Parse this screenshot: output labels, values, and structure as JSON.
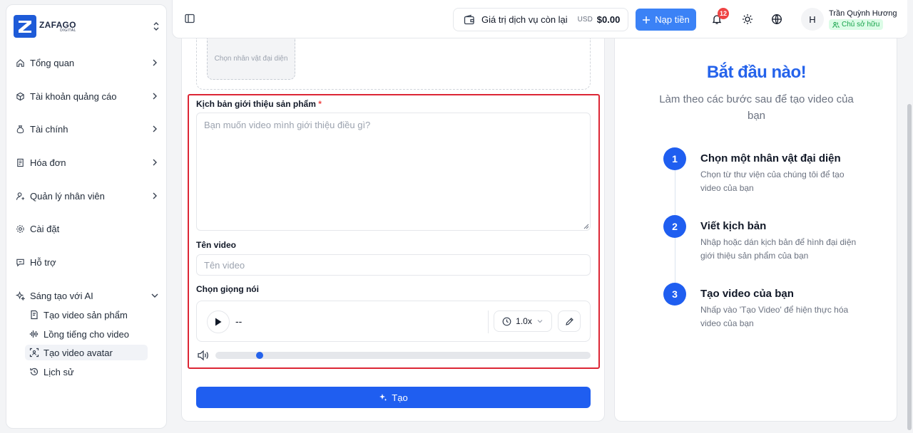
{
  "brand": {
    "name": "ZAFAGO",
    "sub": "DIGITAL",
    "color": "#1e5bd8"
  },
  "sidebar": {
    "items": [
      {
        "label": "Tổng quan",
        "icon": "home-icon",
        "has_chevron": true
      },
      {
        "label": "Tài khoản quảng cáo",
        "icon": "cube-icon",
        "has_chevron": true
      },
      {
        "label": "Tài chính",
        "icon": "money-bag-icon",
        "has_chevron": true
      },
      {
        "label": "Hóa đơn",
        "icon": "receipt-icon",
        "has_chevron": true
      },
      {
        "label": "Quản lý nhân viên",
        "icon": "user-icon",
        "has_chevron": true
      },
      {
        "label": "Cài đặt",
        "icon": "gear-icon",
        "has_chevron": false
      },
      {
        "label": "Hỗ trợ",
        "icon": "chat-icon",
        "has_chevron": false
      },
      {
        "label": "Sáng tạo với AI",
        "icon": "sparkle-icon",
        "expanded": true
      }
    ],
    "subitems": [
      {
        "label": "Tạo video sản phẩm",
        "icon": "document-edit-icon"
      },
      {
        "label": "Lồng tiếng cho video",
        "icon": "audio-wave-icon"
      },
      {
        "label": "Tạo video avatar",
        "icon": "face-scan-icon",
        "active": true
      },
      {
        "label": "Lịch sử",
        "icon": "history-icon"
      }
    ]
  },
  "header": {
    "balance_label": "Giá trị dịch vụ còn lại",
    "currency": "USD",
    "amount": "$0.00",
    "topup_label": "Nạp tiền",
    "notifications": "12",
    "user_initial": "H",
    "user_name": "Trần Quỳnh Hương",
    "user_role": "Chủ sở hữu",
    "accent": "#3b82f6"
  },
  "form": {
    "avatar_slot_label": "Chọn nhân vật đại diện",
    "script_label": "Kịch bản giới thiệu sản phẩm",
    "script_required": "*",
    "script_value": "",
    "script_placeholder": "Bạn muốn video mình giới thiệu điều gì?",
    "name_label": "Tên video",
    "name_value": "",
    "name_placeholder": "Tên video",
    "voice_label": "Chọn giọng nói",
    "voice_name": "--",
    "speed": "1.0x",
    "volume": 0.11,
    "submit_label": "Tạo",
    "highlight_color": "#dc2635"
  },
  "guide": {
    "title": "Bắt đầu nào!",
    "subtitle": "Làm theo các bước sau để tạo video của bạn",
    "steps": [
      {
        "num": "1",
        "title": "Chọn một nhân vật đại diện",
        "desc": "Chọn từ thư viện của chúng tôi để tạo video của bạn"
      },
      {
        "num": "2",
        "title": "Viết kịch bản",
        "desc": "Nhập hoặc dán kịch bản để hình đại diện giới thiệu sản phẩm của bạn"
      },
      {
        "num": "3",
        "title": "Tạo video của bạn",
        "desc": "Nhấp vào 'Tạo Video' để hiện thực hóa video của bạn"
      }
    ]
  }
}
